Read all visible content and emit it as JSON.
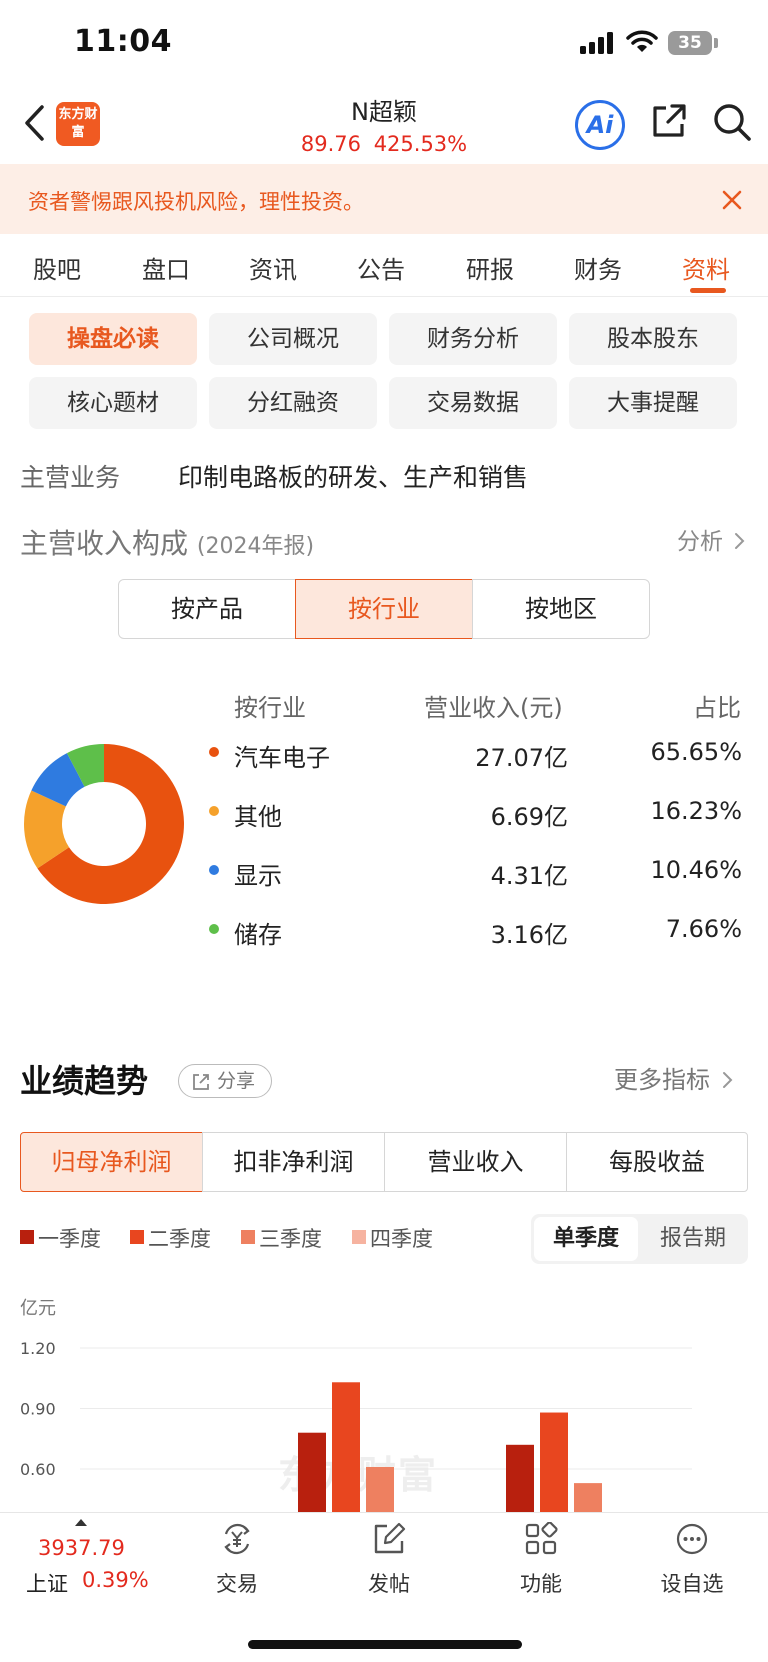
{
  "status_bar": {
    "time": "11:04",
    "battery": "35"
  },
  "header": {
    "logo_text": "东方财富",
    "stock_name": "N超颖",
    "price": "89.76",
    "change_pct": "425.53%",
    "ai_label": "Ai",
    "back_icon": "chevron-left-icon",
    "share_icon": "share-external-icon",
    "search_icon": "search-icon"
  },
  "banner": {
    "text": "资者警惕跟风投机风险，理性投资。",
    "close_icon": "close-icon"
  },
  "tabs": [
    {
      "label": "股吧",
      "active": false
    },
    {
      "label": "盘口",
      "active": false
    },
    {
      "label": "资讯",
      "active": false
    },
    {
      "label": "公告",
      "active": false
    },
    {
      "label": "研报",
      "active": false
    },
    {
      "label": "财务",
      "active": false
    },
    {
      "label": "资料",
      "active": true
    }
  ],
  "sub_tabs": [
    {
      "label": "操盘必读",
      "active": true
    },
    {
      "label": "公司概况",
      "active": false
    },
    {
      "label": "财务分析",
      "active": false
    },
    {
      "label": "股本股东",
      "active": false
    },
    {
      "label": "核心题材",
      "active": false
    },
    {
      "label": "分红融资",
      "active": false
    },
    {
      "label": "交易数据",
      "active": false
    },
    {
      "label": "大事提醒",
      "active": false
    }
  ],
  "main_business": {
    "label": "主营业务",
    "value": "印制电路板的研发、生产和销售"
  },
  "revenue_composition": {
    "title": "主营收入构成",
    "year": "(2024年报)",
    "analysis_link": "分析",
    "segments": [
      {
        "label": "按产品",
        "active": false
      },
      {
        "label": "按行业",
        "active": true
      },
      {
        "label": "按地区",
        "active": false
      }
    ],
    "table_headers": {
      "name": "按行业",
      "revenue": "营业收入(元)",
      "pct": "占比"
    },
    "rows": [
      {
        "name": "汽车电子",
        "revenue": "27.07亿",
        "pct": "65.65%",
        "color": "#e8520f",
        "share": 65.65
      },
      {
        "name": "其他",
        "revenue": "6.69亿",
        "pct": "16.23%",
        "color": "#f5a12b",
        "share": 16.23
      },
      {
        "name": "显示",
        "revenue": "4.31亿",
        "pct": "10.46%",
        "color": "#2f7be0",
        "share": 10.46
      },
      {
        "name": "储存",
        "revenue": "3.16亿",
        "pct": "7.66%",
        "color": "#5ebf4a",
        "share": 7.66
      }
    ]
  },
  "performance": {
    "title": "业绩趋势",
    "share_label": "分享",
    "more_label": "更多指标",
    "metric_tabs": [
      {
        "label": "归母净利润",
        "active": true
      },
      {
        "label": "扣非净利润",
        "active": false
      },
      {
        "label": "营业收入",
        "active": false
      },
      {
        "label": "每股收益",
        "active": false
      }
    ],
    "legend": [
      {
        "label": "一季度",
        "color": "#b8200e"
      },
      {
        "label": "二季度",
        "color": "#e8461f"
      },
      {
        "label": "三季度",
        "color": "#ee8060"
      },
      {
        "label": "四季度",
        "color": "#f6b3a0"
      }
    ],
    "period_toggle": {
      "single": "单季度",
      "report": "报告期"
    },
    "unit": "亿元",
    "watermark": "东方财富"
  },
  "chart_data": {
    "type": "bar",
    "ylabel": "亿元",
    "yticks": [
      "1.20",
      "0.90",
      "0.60"
    ],
    "ylim": [
      0.6,
      1.2
    ],
    "series": [
      {
        "name": "一季度",
        "values": [
          0.78,
          0.72
        ]
      },
      {
        "name": "二季度",
        "values": [
          1.03,
          0.88
        ]
      },
      {
        "name": "三季度",
        "values": [
          0.61,
          0.53
        ]
      }
    ]
  },
  "bottom_bar": {
    "index_value": "3937.79",
    "index_name": "上证",
    "index_change": "0.39%",
    "nav": [
      {
        "label": "交易",
        "icon": "yuan-exchange-icon"
      },
      {
        "label": "发帖",
        "icon": "edit-post-icon"
      },
      {
        "label": "功能",
        "icon": "grid-apps-icon"
      },
      {
        "label": "设自选",
        "icon": "more-dots-icon"
      }
    ]
  }
}
